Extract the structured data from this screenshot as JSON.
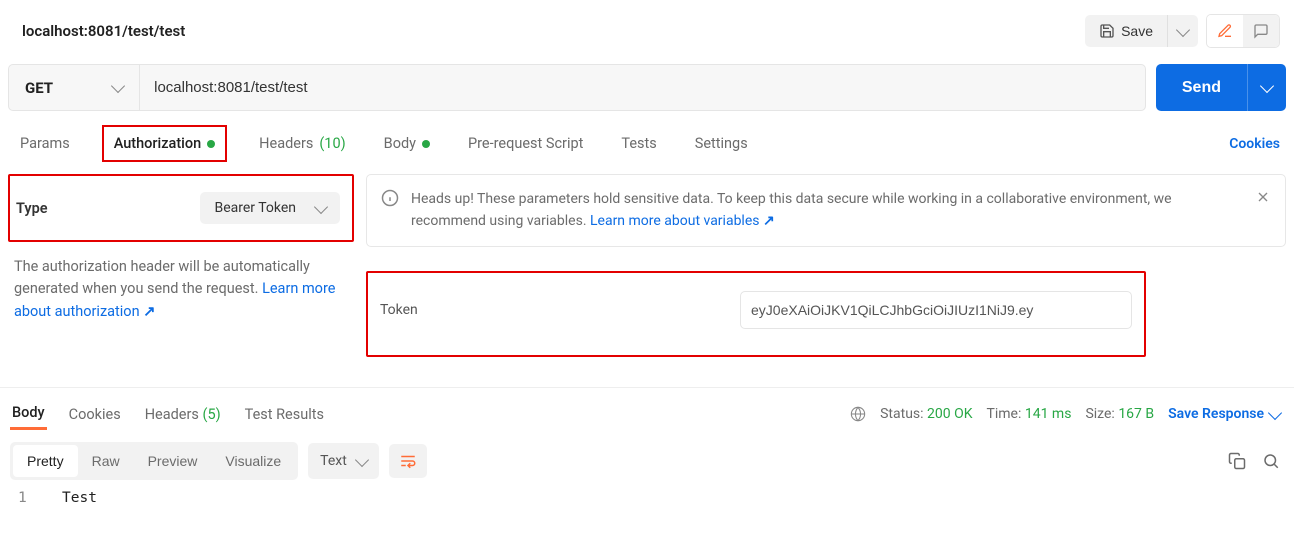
{
  "header": {
    "tab_title": "localhost:8081/test/test",
    "save_label": "Save"
  },
  "request": {
    "method": "GET",
    "url": "localhost:8081/test/test",
    "send_label": "Send"
  },
  "request_tabs": {
    "params": "Params",
    "authorization": "Authorization",
    "headers_label": "Headers",
    "headers_count": "(10)",
    "body": "Body",
    "pre_request": "Pre-request Script",
    "tests": "Tests",
    "settings": "Settings",
    "cookies_link": "Cookies"
  },
  "auth": {
    "type_label": "Type",
    "type_value": "Bearer Token",
    "description_1": "The authorization header will be automatically generated when you send the request. ",
    "learn_more": "Learn more about authorization",
    "banner_msg": "Heads up! These parameters hold sensitive data. To keep this data secure while working in a collaborative environment, we recommend using variables. ",
    "banner_link": "Learn more about variables",
    "token_label": "Token",
    "token_value": "eyJ0eXAiOiJKV1QiLCJhbGciOiJIUzI1NiJ9.ey"
  },
  "response": {
    "tabs": {
      "body": "Body",
      "cookies": "Cookies",
      "headers_label": "Headers",
      "headers_count": "(5)",
      "test_results": "Test Results"
    },
    "status_label": "Status:",
    "status_value": "200 OK",
    "time_label": "Time:",
    "time_value": "141 ms",
    "size_label": "Size:",
    "size_value": "167 B",
    "save_response": "Save Response",
    "view_modes": {
      "pretty": "Pretty",
      "raw": "Raw",
      "preview": "Preview",
      "visualize": "Visualize"
    },
    "format": "Text",
    "body_line_no": "1",
    "body_content": "Test"
  }
}
